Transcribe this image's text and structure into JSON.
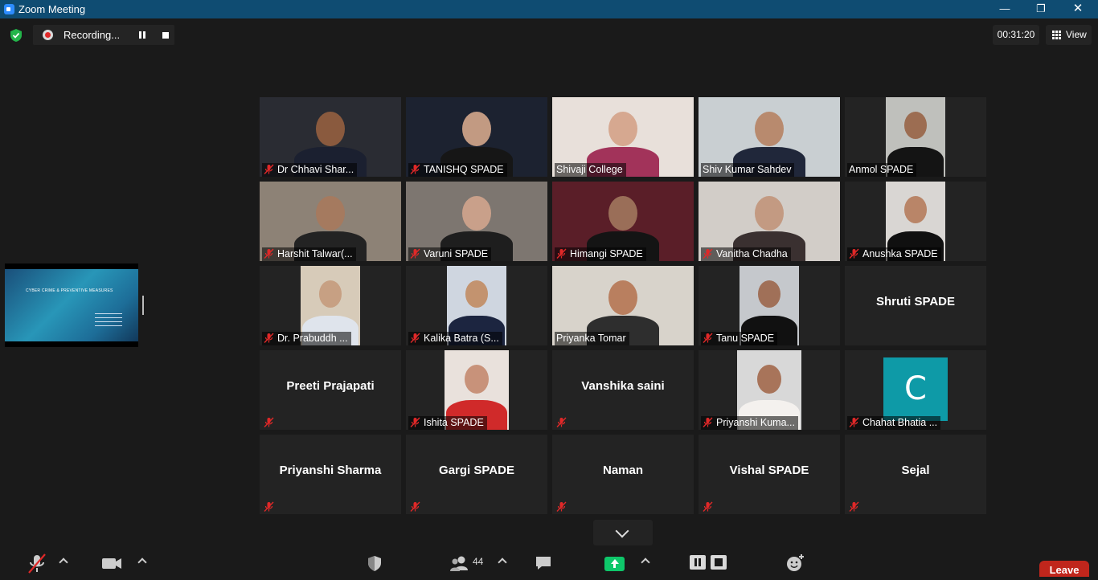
{
  "window": {
    "title": "Zoom Meeting",
    "minimize": "—",
    "maximize": "❐",
    "close": "✕"
  },
  "recording": {
    "label": "Recording..."
  },
  "timer": "00:31:20",
  "view_label": "View",
  "shared_screen": {
    "slide_title": "CYBER CRIME & PREVENTIVE MEASURES"
  },
  "participants": [
    {
      "name": "Dr Chhavi Shar...",
      "video": true,
      "muted": true
    },
    {
      "name": "TANISHQ SPADE",
      "video": true,
      "muted": true
    },
    {
      "name": "Shivaji College",
      "video": true,
      "muted": false
    },
    {
      "name": "Shiv Kumar Sahdev",
      "video": true,
      "muted": false,
      "active_speaker": true
    },
    {
      "name": "Anmol SPADE",
      "video": true,
      "muted": false
    },
    {
      "name": "Harshit Talwar(...",
      "video": true,
      "muted": true
    },
    {
      "name": "Varuni SPADE",
      "video": true,
      "muted": true
    },
    {
      "name": "Himangi SPADE",
      "video": true,
      "muted": true
    },
    {
      "name": "Vanitha Chadha",
      "video": true,
      "muted": true
    },
    {
      "name": "Anushka SPADE",
      "video": true,
      "muted": true
    },
    {
      "name": "Dr. Prabuddh ...",
      "video": true,
      "muted": true
    },
    {
      "name": "Kalika Batra (S...",
      "video": true,
      "muted": true
    },
    {
      "name": "Priyanka Tomar",
      "video": true,
      "muted": false
    },
    {
      "name": "Tanu SPADE",
      "video": true,
      "muted": true
    },
    {
      "name": "Shruti SPADE",
      "video": false,
      "muted": false
    },
    {
      "name": "Preeti Prajapati",
      "video": false,
      "muted": true
    },
    {
      "name": "Ishita SPADE",
      "video": true,
      "muted": true
    },
    {
      "name": "Vanshika saini",
      "video": false,
      "muted": true
    },
    {
      "name": "Priyanshi Kuma...",
      "video": true,
      "muted": true
    },
    {
      "name": "Chahat Bhatia ...",
      "video": false,
      "muted": true,
      "avatar_letter": "C"
    },
    {
      "name": "Priyanshi Sharma",
      "video": false,
      "muted": true
    },
    {
      "name": "Gargi SPADE",
      "video": false,
      "muted": true
    },
    {
      "name": "Naman",
      "video": false,
      "muted": true
    },
    {
      "name": "Vishal SPADE",
      "video": false,
      "muted": true
    },
    {
      "name": "Sejal",
      "video": false,
      "muted": true
    }
  ],
  "toolbar": {
    "participants_count": "44",
    "leave_label": "Leave"
  },
  "colors": {
    "titlebar": "#0f4c72",
    "active_speaker": "#b3e33b",
    "leave": "#c0261c",
    "share": "#0ec76a",
    "muted_icon": "#e02828"
  }
}
